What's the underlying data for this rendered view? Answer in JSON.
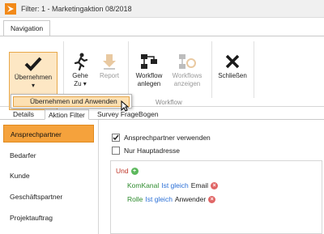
{
  "window": {
    "title": "Filter: 1 - Marketingaktion 08/2018"
  },
  "ribbon": {
    "tab": "Navigation",
    "buttons": {
      "apply": {
        "line1": "Übernehmen",
        "arrow": "▾"
      },
      "goto": {
        "line1": "Gehe",
        "line2": "Zu ▾"
      },
      "report": {
        "line1": "Report"
      },
      "workflow": {
        "line1": "Workflow",
        "line2": "anlegen"
      },
      "workflows": {
        "line1": "Workflows",
        "line2": "anzeigen"
      },
      "close": {
        "line1": "Schließen"
      }
    },
    "group_workflow": "Workflow",
    "group_left_fragment": "Fi"
  },
  "dropdown": {
    "item": "Übernehmen und Anwenden"
  },
  "content_tabs": {
    "details": "Details",
    "action_filter": "Aktion Filter",
    "survey": "Survey FrageBogen"
  },
  "sidebar": {
    "items": [
      {
        "label": "Ansprechpartner"
      },
      {
        "label": "Bedarfer"
      },
      {
        "label": "Kunde"
      },
      {
        "label": "Geschäftspartner"
      },
      {
        "label": "Projektauftrag"
      }
    ]
  },
  "options": {
    "use_contact": {
      "label": "Ansprechpartner verwenden",
      "checked": true
    },
    "main_address": {
      "label": "Nur Hauptadresse",
      "checked": false
    }
  },
  "filter": {
    "root_op": "Und",
    "conditions": [
      {
        "field": "KomKanal",
        "comparator": "Ist gleich",
        "value": "Email"
      },
      {
        "field": "Rolle",
        "comparator": "Ist gleich",
        "value": "Anwender"
      }
    ]
  },
  "colors": {
    "accent": "#f5a23c",
    "add": "#5cb85c",
    "remove": "#e06666",
    "and": "#c0392b",
    "field": "#2e8b2e",
    "comparator": "#2a6fd6"
  }
}
